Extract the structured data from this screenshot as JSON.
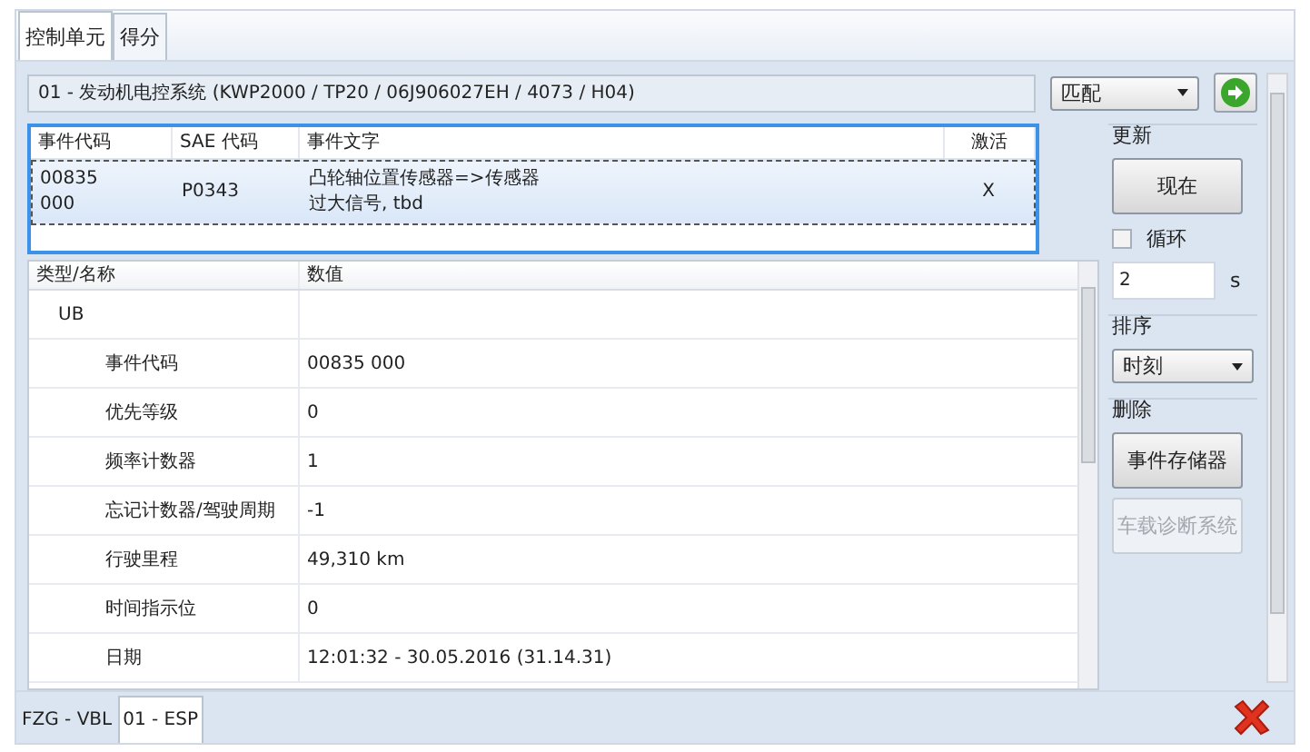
{
  "tabs": [
    {
      "label": "控制单元",
      "selected": true
    },
    {
      "label": "得分",
      "selected": false
    }
  ],
  "module": {
    "value": "01 - 发动机电控系统  (KWP2000 / TP20 / 06J906027EH  / 4073 / H04)",
    "mode": "匹配"
  },
  "events": {
    "columns": [
      "事件代码",
      "SAE 代码",
      "事件文字",
      "激活"
    ],
    "rows": [
      {
        "code": [
          "00835",
          "000"
        ],
        "sae": "P0343",
        "text": [
          "凸轮轴位置传感器=>传感器",
          "过大信号, tbd"
        ],
        "active": "X",
        "selected": true
      }
    ]
  },
  "update": {
    "label": "更新",
    "button": "现在",
    "loop": {
      "label": "循环",
      "checked": false
    },
    "interval": "2",
    "unit": "s"
  },
  "sort": {
    "label": "排序",
    "value": "时刻"
  },
  "delete": {
    "label": "删除",
    "buttons": [
      {
        "label": "事件存储器",
        "disabled": false
      },
      {
        "label": "车载诊断系统",
        "disabled": true
      }
    ]
  },
  "details": {
    "columns": [
      "类型/名称",
      "数值"
    ],
    "rows": [
      {
        "name": "UB",
        "children": [
          {
            "name": "事件代码",
            "value": "00835 000"
          },
          {
            "name": "优先等级",
            "value": "0"
          },
          {
            "name": "频率计数器",
            "value": "1"
          },
          {
            "name": "忘记计数器/驾驶周期",
            "value": "-1"
          },
          {
            "name": "行驶里程",
            "value": "49,310 km"
          },
          {
            "name": "时间指示位",
            "value": "0"
          },
          {
            "name": "日期",
            "value": "12:01:32 - 30.05.2016  (31.14.31)"
          }
        ]
      }
    ]
  },
  "bottom_tabs": [
    {
      "label": "FZG - VBL",
      "selected": false
    },
    {
      "label": "01 - ESP",
      "selected": true
    }
  ]
}
